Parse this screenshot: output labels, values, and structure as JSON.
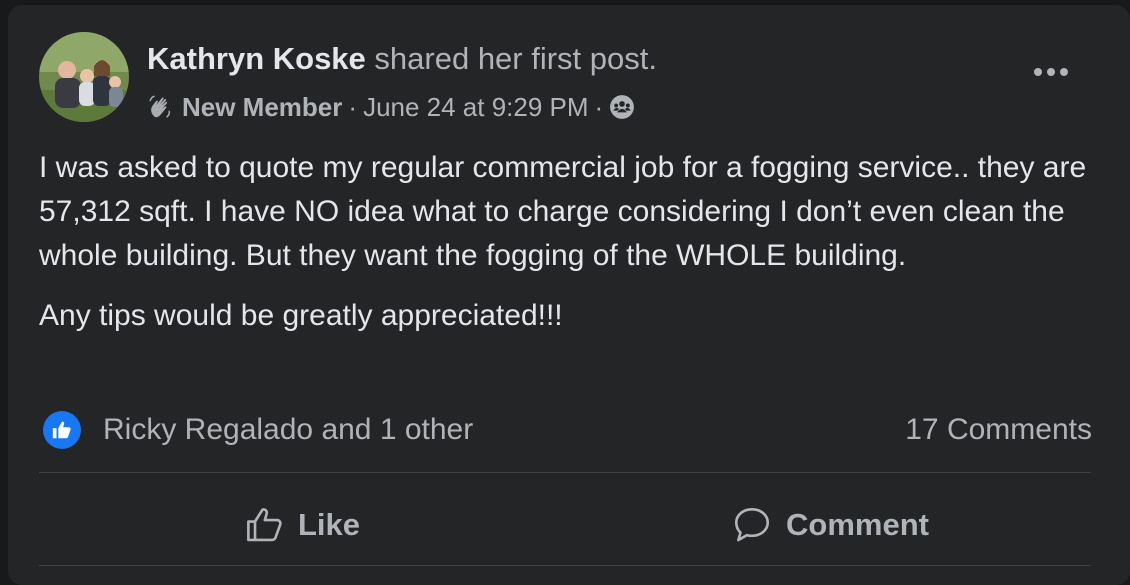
{
  "post": {
    "author_name": "Kathryn Koske",
    "author_action": "shared her first post.",
    "badge": "New Member",
    "separator": "·",
    "timestamp": "June 24 at 9:29 PM",
    "audience_icon": "group-icon",
    "more_icon": "more-options-icon",
    "body": [
      "I was asked to quote my regular commercial job for a fogging service.. they are 57,312 sqft. I have NO idea what to charge considering I don’t even clean the whole building. But they want the fogging of the WHOLE building.",
      "Any tips would be greatly appreciated!!!"
    ]
  },
  "reactions": {
    "icon": "like-reaction-icon",
    "names": "Ricky Regalado and 1 other",
    "comments": "17 Comments"
  },
  "actions": {
    "like_label": "Like",
    "comment_label": "Comment"
  },
  "colors": {
    "background": "#18191a",
    "card": "#242526",
    "primary_text": "#e4e6eb",
    "secondary_text": "#b0b3b8",
    "divider": "#3e4042",
    "like_blue": "#1877f2"
  }
}
